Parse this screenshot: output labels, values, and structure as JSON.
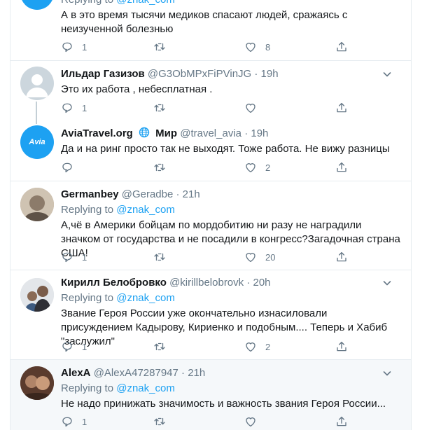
{
  "tweets": [
    {
      "reply_prefix": "Replying to",
      "reply_to": "@znak_com",
      "text": "А в это время тысячи медиков спасают людей, сражаясь с неизученной болезнью",
      "reply_count": "1",
      "retweet_count": "",
      "like_count": "8"
    },
    {
      "name": "Ильдар Газизов",
      "handle": "@G3ObMPxFiPVinJG",
      "dot": "·",
      "time": "19h",
      "text": "Это их работа , небесплатная .",
      "reply_count": "1",
      "retweet_count": "",
      "like_count": ""
    },
    {
      "name": "AviaTravel.org",
      "name_suffix": "Мир",
      "handle": "@travel_avia",
      "dot": "·",
      "time": "19h",
      "avatar_text": "Avia",
      "text": "Да и на ринг просто так не выходят. Тоже работа. Не вижу разницы",
      "reply_count": "",
      "retweet_count": "",
      "like_count": "2"
    },
    {
      "name": "Germanbey",
      "handle": "@Geradbe",
      "dot": "·",
      "time": "21h",
      "reply_prefix": "Replying to",
      "reply_to": "@znak_com",
      "text": "А,чё в Америки бойцам по мордобитию ни разу не наградили значком от государства и не посадили в конгресс?Загадочная страна США!",
      "reply_count": "1",
      "retweet_count": "",
      "like_count": "20"
    },
    {
      "name": "Кирилл Белобровко",
      "handle": "@kirillbelobrovk",
      "dot": "·",
      "time": "20h",
      "reply_prefix": "Replying to",
      "reply_to": "@znak_com",
      "text": "Звание Героя России уже окончательно изнасиловали присуждением Кадырову, Кириенко и подобным.... Теперь и Хабиб \"заслужил\"",
      "reply_count": "1",
      "retweet_count": "",
      "like_count": "2"
    },
    {
      "name": "AlexA",
      "handle": "@AlexA47287947",
      "dot": "·",
      "time": "21h",
      "reply_prefix": "Replying to",
      "reply_to": "@znak_com",
      "text": "Не надо принижать значимость и важность звания Героя России...",
      "reply_count": "1",
      "retweet_count": "",
      "like_count": ""
    }
  ],
  "colors": {
    "accent": "#1da1f2",
    "secondary_text": "#657786",
    "thread_line": "#c4cfd6",
    "border": "#e6ecf0",
    "highlight_bg": "#f5f8fa"
  },
  "icons": {
    "reply": "reply-icon",
    "retweet": "retweet-icon",
    "like": "heart-icon",
    "share": "share-icon",
    "more": "chevron-down-icon",
    "globe": "globe-icon"
  }
}
